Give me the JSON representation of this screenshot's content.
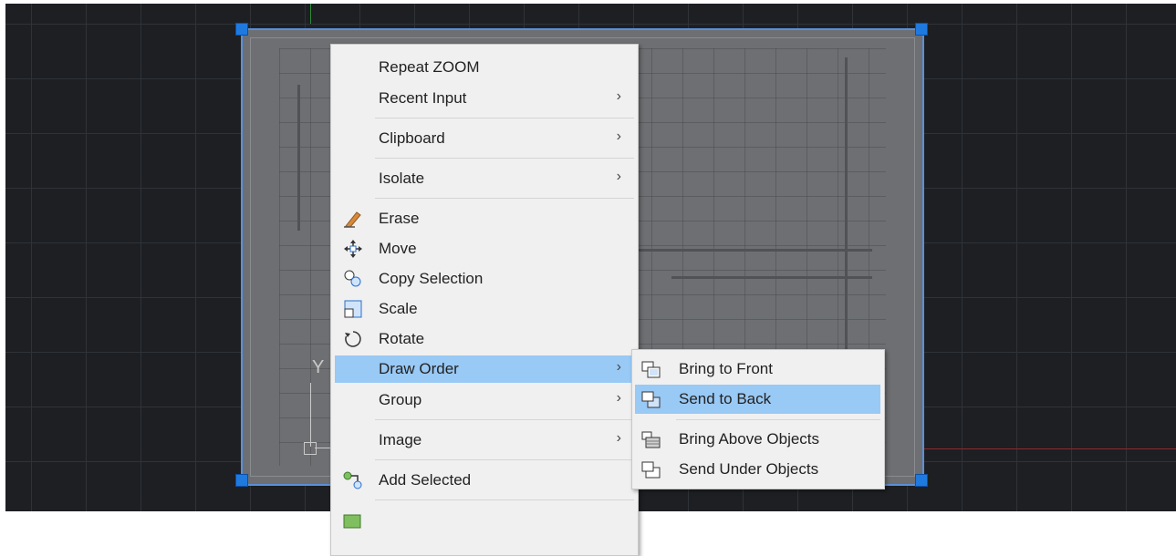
{
  "context_menu": {
    "items": [
      {
        "label": "Repeat ZOOM",
        "icon": "",
        "submenu": false
      },
      {
        "label": "Recent Input",
        "icon": "",
        "submenu": true
      },
      {
        "label": "Clipboard",
        "icon": "",
        "submenu": true
      },
      {
        "label": "Isolate",
        "icon": "",
        "submenu": true
      },
      {
        "label": "Erase",
        "icon": "eraser-icon",
        "submenu": false
      },
      {
        "label": "Move",
        "icon": "move-icon",
        "submenu": false
      },
      {
        "label": "Copy Selection",
        "icon": "copy-selection-icon",
        "submenu": false
      },
      {
        "label": "Scale",
        "icon": "scale-icon",
        "submenu": false
      },
      {
        "label": "Rotate",
        "icon": "rotate-icon",
        "submenu": false
      },
      {
        "label": "Draw Order",
        "icon": "",
        "submenu": true,
        "highlighted": true
      },
      {
        "label": "Group",
        "icon": "",
        "submenu": true
      },
      {
        "label": "Image",
        "icon": "",
        "submenu": true
      },
      {
        "label": "Add Selected",
        "icon": "add-selected-icon",
        "submenu": false
      }
    ],
    "submenu_arrow": "›"
  },
  "draw_order_submenu": {
    "items": [
      {
        "label": "Bring to Front",
        "icon": "bring-to-front-icon"
      },
      {
        "label": "Send to Back",
        "icon": "send-to-back-icon",
        "highlighted": true
      },
      {
        "label": "Bring Above Objects",
        "icon": "bring-above-objects-icon"
      },
      {
        "label": "Send Under Objects",
        "icon": "send-under-objects-icon"
      }
    ]
  },
  "ucs": {
    "y_label": "Y"
  },
  "colors": {
    "canvas_bg": "#1d1f23",
    "menu_bg": "#f0f0f0",
    "highlight": "#99c9f5",
    "grip": "#1f7ae0",
    "selection_border": "#5b8fd8"
  }
}
